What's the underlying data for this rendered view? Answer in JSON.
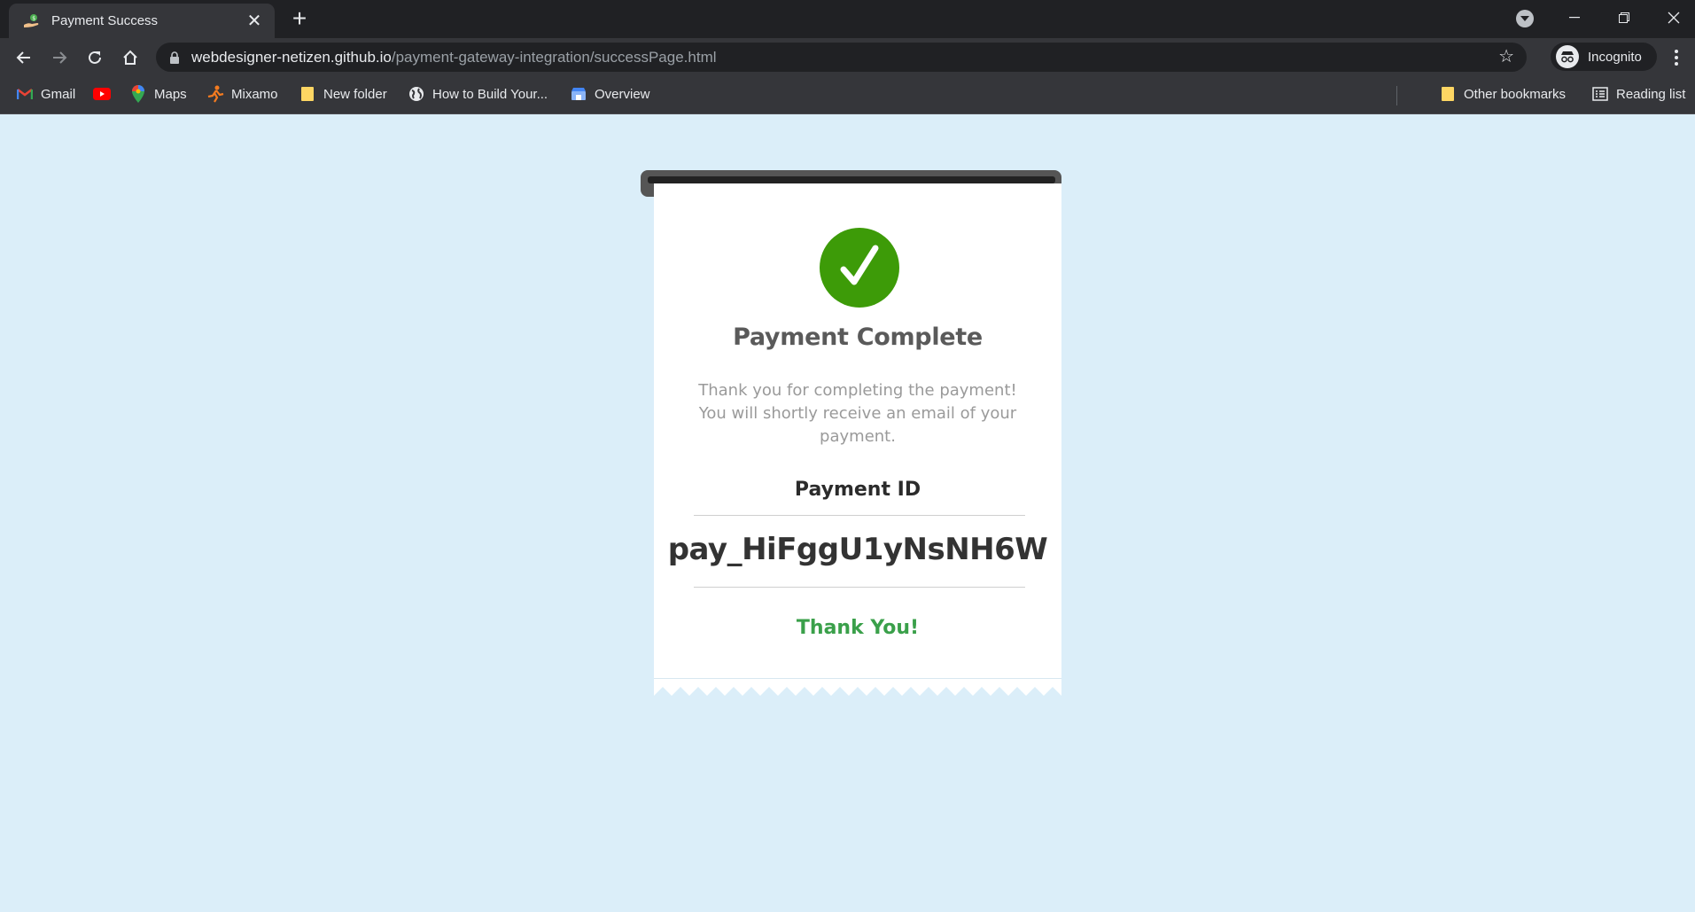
{
  "browser": {
    "tab": {
      "title": "Payment Success",
      "close_glyph": "✕"
    },
    "new_tab_glyph": "+",
    "address": {
      "host": "webdesigner-netizen.github.io",
      "path": "/payment-gateway-integration/successPage.html"
    },
    "profile_label": "Incognito",
    "bookmarks": [
      {
        "label": "Gmail",
        "icon": "gmail-icon"
      },
      {
        "label": "",
        "icon": "youtube-icon"
      },
      {
        "label": "Maps",
        "icon": "maps-icon"
      },
      {
        "label": "Mixamo",
        "icon": "mixamo-icon"
      },
      {
        "label": "New folder",
        "icon": "folder-icon"
      },
      {
        "label": "How to Build Your...",
        "icon": "globe-icon"
      },
      {
        "label": "Overview",
        "icon": "overview-icon"
      }
    ],
    "other_bookmarks": "Other bookmarks",
    "reading_list": "Reading list"
  },
  "page": {
    "title": "Payment Complete",
    "message": "Thank you for completing the payment! You will shortly receive an email of your payment.",
    "payment_id_label": "Payment ID",
    "payment_id": "pay_HiFggU1yNsNH6W",
    "thanks": "Thank You!"
  },
  "colors": {
    "page_background": "#dbeef9",
    "success_green": "#3d9b08",
    "thanks_green": "#3aa04a",
    "chrome_dark": "#202124",
    "chrome_toolbar": "#35363a"
  }
}
